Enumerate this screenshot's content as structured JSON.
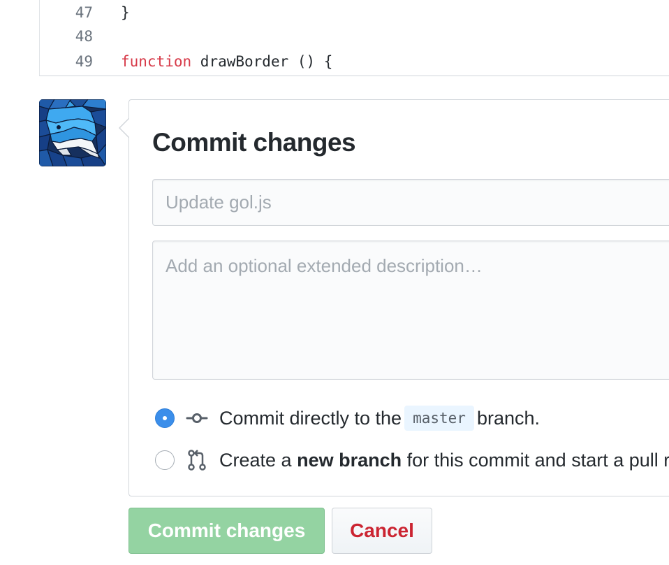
{
  "code": {
    "lines": [
      {
        "number": "47",
        "keyword": "",
        "text": "}"
      },
      {
        "number": "48",
        "keyword": "",
        "text": ""
      },
      {
        "number": "49",
        "keyword": "function",
        "text": " drawBorder () {"
      }
    ]
  },
  "commit_form": {
    "title": "Commit changes",
    "summary_placeholder": "Update gol.js",
    "description_placeholder": "Add an optional extended description…",
    "option_direct": {
      "prefix": "Commit directly to the",
      "branch": "master",
      "suffix": "branch.",
      "selected": true,
      "icon": "git-commit-icon"
    },
    "option_new_branch": {
      "prefix": "Create a",
      "bold": "new branch",
      "suffix": "for this commit and start a pull request.",
      "selected": false,
      "icon": "git-pull-request-icon"
    }
  },
  "buttons": {
    "commit_label": "Commit changes",
    "cancel_label": "Cancel"
  },
  "colors": {
    "radio_selected": "#3b8eea",
    "commit_button": "#94d3a2",
    "cancel_text": "#cb2431",
    "keyword": "#d73a49"
  },
  "avatar": {
    "icon": "shark-avatar"
  }
}
